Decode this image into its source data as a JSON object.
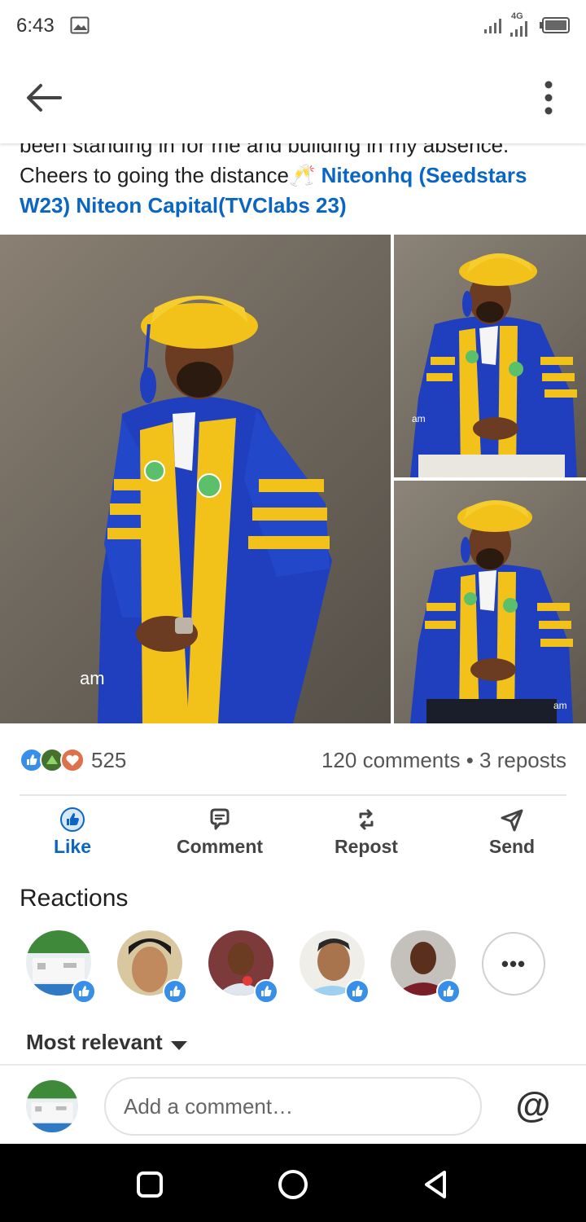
{
  "status_bar": {
    "time": "6:43",
    "network": "4G",
    "icons": [
      "image-icon",
      "signal-icon",
      "signal-4g-icon",
      "battery-icon"
    ]
  },
  "app_bar": {
    "back_icon": "arrow-left-icon",
    "more_icon": "more-vertical-icon"
  },
  "post": {
    "text_line1": "been standing in for me and building in my absence.",
    "text_line2": "Cheers to going the distance",
    "emoji": "🥂",
    "mention1": "Niteonhq (Seedstars W23)",
    "mention2": "Niteon Capital(TVClabs 23)",
    "images": [
      {
        "description": "graduate-in-gown-standing",
        "watermark": "am"
      },
      {
        "description": "graduate-in-gown-seated",
        "watermark": "am"
      },
      {
        "description": "graduate-in-gown-seated-2",
        "watermark": "am"
      }
    ]
  },
  "social": {
    "reaction_count": "525",
    "comments_reposts": "120 comments • 3 reposts",
    "reaction_types": [
      "like-icon",
      "celebrate-icon",
      "love-icon"
    ]
  },
  "actions": {
    "like": "Like",
    "comment": "Comment",
    "repost": "Repost",
    "send": "Send"
  },
  "reactions_section": {
    "title": "Reactions",
    "more": "•••"
  },
  "sort": {
    "label": "Most relevant"
  },
  "comment_bar": {
    "placeholder": "Add a comment…",
    "mention_symbol": "@"
  },
  "nav_bar": {
    "icons": [
      "recents-square-icon",
      "home-circle-icon",
      "back-triangle-icon"
    ]
  },
  "colors": {
    "accent": "#0a66c2",
    "gown_blue": "#1f3fbf",
    "gown_gold": "#f2c21a"
  }
}
